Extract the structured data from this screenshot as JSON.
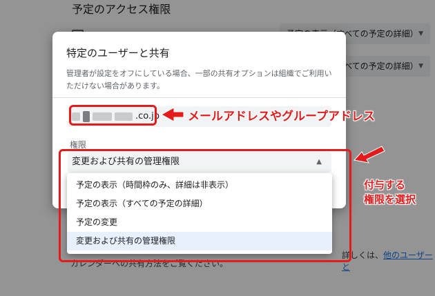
{
  "background": {
    "section_title": "予定のアクセス権限",
    "select_1_label": "予定の表示（すべての予定の詳細）",
    "select_2_label": "予定の表示（すべての予定の詳細）",
    "bottom_text": "カレンダーへの共有方法をご覧ください。",
    "bottom_text_right_prefix": "詳しくは、",
    "bottom_link": "他のユーザーと"
  },
  "dialog": {
    "title": "特定のユーザーと共有",
    "note": "管理者が設定をオフにしている場合、一部の共有オプションは組織でご利用いただけない場合があります。",
    "email_suffix": ".co.jp",
    "permission_label": "権限",
    "permission_selected": "変更および共有の管理権限",
    "dropdown_icon": "triangle-up-icon"
  },
  "menu": {
    "items": [
      {
        "label": "予定の表示（時間枠のみ、詳細は非表示）"
      },
      {
        "label": "予定の表示（すべての予定の詳細）"
      },
      {
        "label": "予定の変更"
      },
      {
        "label": "変更および共有の管理権限"
      }
    ],
    "selected_index": 3
  },
  "annotations": {
    "email_callout": "メールアドレスやグループアドレス",
    "permission_callout_line1": "付与する",
    "permission_callout_line2": "権限を選択",
    "color": "#e31b1b"
  }
}
